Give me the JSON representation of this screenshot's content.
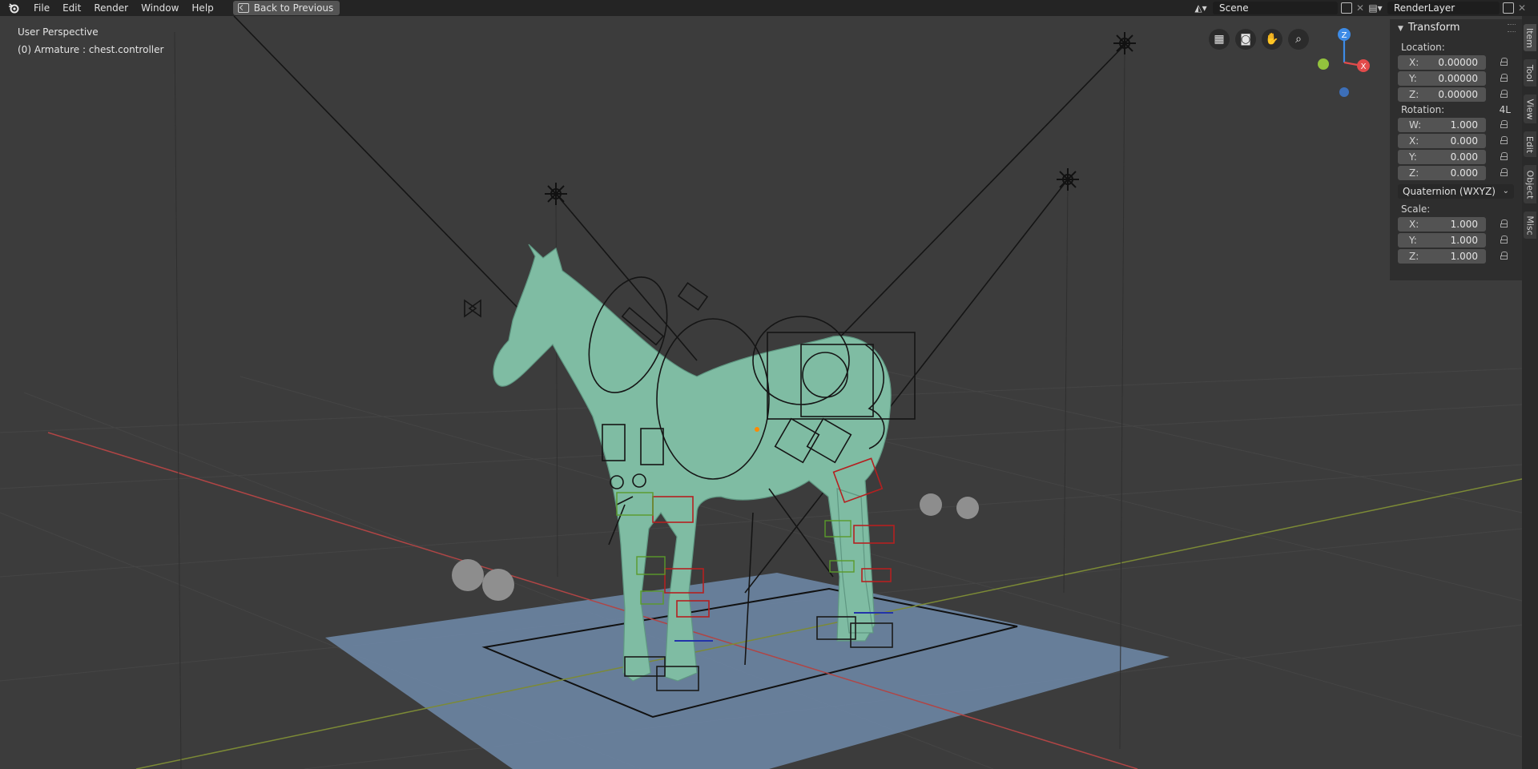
{
  "topbar": {
    "menus": [
      "File",
      "Edit",
      "Render",
      "Window",
      "Help"
    ],
    "back_button": "Back to Previous",
    "scene_field": "Scene",
    "render_layer_field": "RenderLayer"
  },
  "viewport": {
    "perspective_label": "User Perspective",
    "active_object_label": "(0) Armature : chest.controller",
    "gizmo": {
      "z": "Z",
      "x": "X"
    },
    "colors": {
      "mesh": "#7fbca3",
      "ground_plane": "#6e8aa9",
      "x_axis": "#b04545",
      "y_axis": "#7c8a36",
      "gizmo_z": "#3d8be6",
      "gizmo_x": "#e24b4b",
      "gizmo_y": "#93c23d"
    }
  },
  "npanel": {
    "title": "Transform",
    "location_label": "Location:",
    "location": [
      {
        "axis": "X:",
        "value": "0.00000"
      },
      {
        "axis": "Y:",
        "value": "0.00000"
      },
      {
        "axis": "Z:",
        "value": "0.00000"
      }
    ],
    "rotation_label": "Rotation:",
    "rotation_mode_badge": "4L",
    "rotation": [
      {
        "axis": "W:",
        "value": "1.000"
      },
      {
        "axis": "X:",
        "value": "0.000"
      },
      {
        "axis": "Y:",
        "value": "0.000"
      },
      {
        "axis": "Z:",
        "value": "0.000"
      }
    ],
    "rotation_mode": "Quaternion (WXYZ)",
    "scale_label": "Scale:",
    "scale": [
      {
        "axis": "X:",
        "value": "1.000"
      },
      {
        "axis": "Y:",
        "value": "1.000"
      },
      {
        "axis": "Z:",
        "value": "1.000"
      }
    ]
  },
  "sidetabs": [
    "Item",
    "Tool",
    "View",
    "Edit",
    "Object",
    "Misc"
  ]
}
